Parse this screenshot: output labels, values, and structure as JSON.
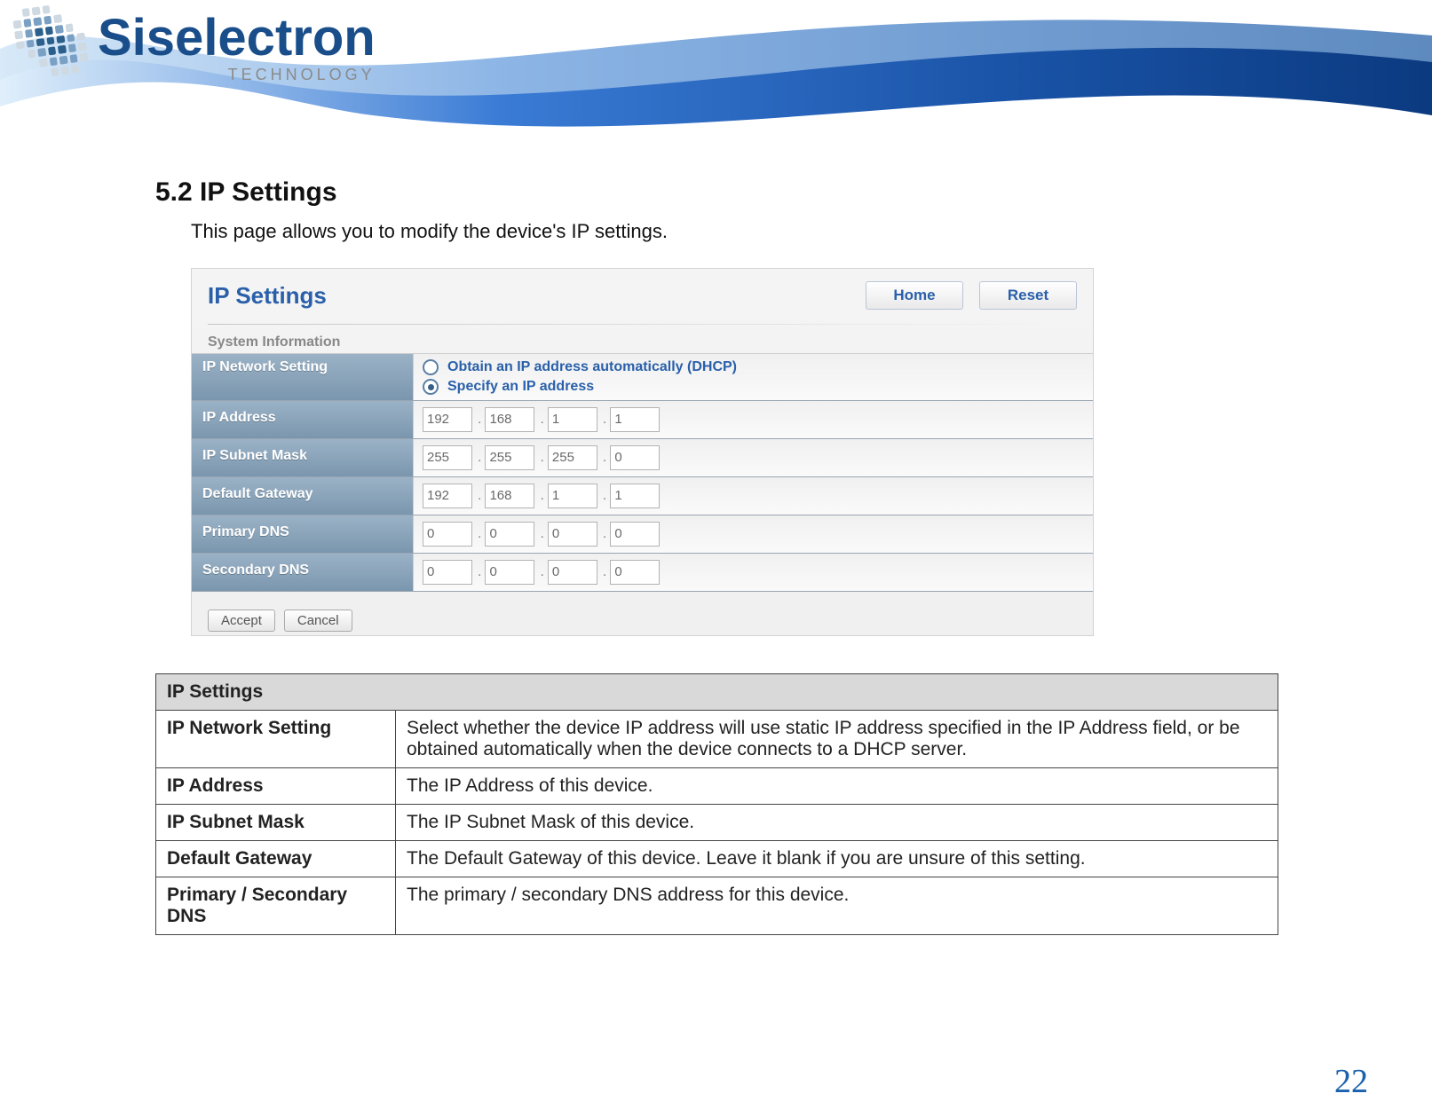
{
  "logo": {
    "brand": "Siselectron",
    "tag1": "TECHNOLOGY",
    "tag2": "·····"
  },
  "section": {
    "number_title": "5.2   IP Settings",
    "intro": "This page allows you to modify the device's IP settings."
  },
  "panel": {
    "title": "IP Settings",
    "home": "Home",
    "reset": "Reset",
    "sysinfo": "System Information",
    "labels": {
      "net": "IP Network Setting",
      "ip": "IP Address",
      "mask": "IP Subnet Mask",
      "gw": "Default Gateway",
      "dns1": "Primary DNS",
      "dns2": "Secondary DNS"
    },
    "radio": {
      "dhcp": "Obtain an IP address automatically (DHCP)",
      "static": "Specify an IP address"
    },
    "ip": [
      "192",
      "168",
      "1",
      "1"
    ],
    "mask": [
      "255",
      "255",
      "255",
      "0"
    ],
    "gw": [
      "192",
      "168",
      "1",
      "1"
    ],
    "dns1": [
      "0",
      "0",
      "0",
      "0"
    ],
    "dns2": [
      "0",
      "0",
      "0",
      "0"
    ],
    "accept": "Accept",
    "cancel": "Cancel"
  },
  "desc": {
    "header": "IP Settings",
    "rows": [
      {
        "k": "IP Network Setting",
        "v": "Select whether the device IP address will use static IP address specified in the IP Address field, or be obtained automatically when the device connects to a DHCP server."
      },
      {
        "k": "IP Address",
        "v": "The IP Address of this device."
      },
      {
        "k": "IP Subnet Mask",
        "v": "The IP Subnet Mask of this device."
      },
      {
        "k": "Default Gateway",
        "v": "The Default Gateway of this device. Leave it blank if you are unsure of this setting."
      },
      {
        "k": "Primary / Secondary DNS",
        "v": "The primary / secondary DNS address for this device."
      }
    ]
  },
  "page_number": "22"
}
